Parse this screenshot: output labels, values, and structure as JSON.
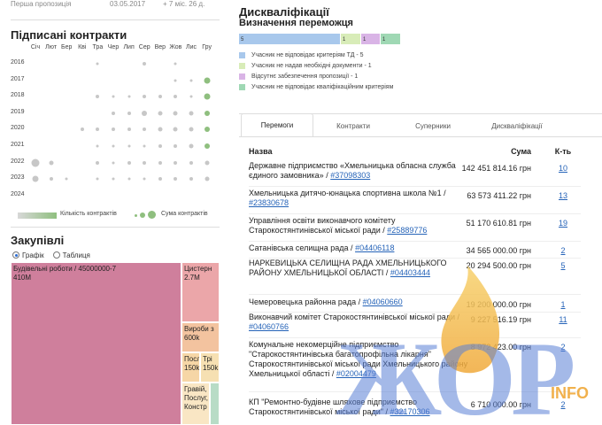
{
  "top_strip": {
    "label": "Перша пропозиція",
    "date": "03.05.2017",
    "duration": "+ 7 міс. 26 д."
  },
  "contracts": {
    "title": "Підписані контракти",
    "months": [
      "Січ",
      "Лют",
      "Бер",
      "Кві",
      "Тра",
      "Чер",
      "Лип",
      "Сер",
      "Вер",
      "Жов",
      "Лис",
      "Гру"
    ],
    "years": [
      "2016",
      "2017",
      "2018",
      "2019",
      "2020",
      "2021",
      "2022",
      "2023",
      "2024"
    ],
    "legend_count": "Кількість контрактів",
    "legend_sum": "Сума контрактів"
  },
  "purchases": {
    "title": "Закупівлі",
    "view_graph": "Графік",
    "view_table": "Таблиця",
    "tiles": [
      {
        "label": "Будівельні роботи / 45000000-7",
        "value": "410М",
        "color": "#cf7f9c"
      },
      {
        "label": "Цистерн",
        "value": "2.7M",
        "color": "#eba6a9"
      },
      {
        "label": "Вироби з",
        "value": "600k",
        "color": "#f3c39f"
      },
      {
        "label": "Посл",
        "value": "150k",
        "color": "#f6d6a6"
      },
      {
        "label": "Трі",
        "value": "150k",
        "color": "#f6e0b2"
      },
      {
        "label": "Гравій, Послуг, Констр",
        "value": "",
        "color": "#f9e6c4"
      },
      {
        "label": "",
        "value": "",
        "color": "#b8dcc6"
      }
    ]
  },
  "disqualifications": {
    "title": "Дискваліфікації",
    "subtitle": "Визначення переможця",
    "bars": [
      {
        "value": "5",
        "color": "#a8c8ec"
      },
      {
        "value": "1",
        "color": "#d8ecb8"
      },
      {
        "value": "1",
        "color": "#d9b4e6"
      },
      {
        "value": "1",
        "color": "#9fd8b4"
      }
    ],
    "legend": [
      {
        "text": "Учасник не відповідає критеріям ТД - 5",
        "color": "#a8c8ec"
      },
      {
        "text": "Учасник не надав необхідні документи - 1",
        "color": "#d8ecb8"
      },
      {
        "text": "Відсутнє забезпечення пропозиції - 1",
        "color": "#d9b4e6"
      },
      {
        "text": "Учасник не відповідає кваліфікаційним критеріям",
        "color": "#9fd8b4"
      }
    ]
  },
  "tabs": [
    "Перемоги",
    "Контракти",
    "Суперники",
    "Дискваліфікації"
  ],
  "table": {
    "col_name": "Назва",
    "col_sum": "Сума",
    "col_count": "К-ть",
    "rows": [
      {
        "name": "Державне підприємство «Хмельницька обласна служба єдиного замовника» / ",
        "code": "#37098303",
        "sum": "142 451 814.16 грн",
        "count": "10"
      },
      {
        "name": "Хмельницька дитячо-юнацька спортивна школа №1 / ",
        "code": "#23830678",
        "sum": "63 573 411.22 грн",
        "count": "13"
      },
      {
        "name": "Управління освіти виконавчого комітету Старокостянтинівської міської ради / ",
        "code": "#25889776",
        "sum": "51 170 610.81 грн",
        "count": "19"
      },
      {
        "name": "Сатанівська селищна рада / ",
        "code": "#04406118",
        "sum": "34 565 000.00 грн",
        "count": "2"
      },
      {
        "name": "НАРКЕВИЦЬКА СЕЛИЩНА РАДА ХМЕЛЬНИЦЬКОГО РАЙОНУ ХМЕЛЬНИЦЬКОЇ ОБЛАСТІ / ",
        "code": "#04403444",
        "sum": "20 294 500.00 грн",
        "count": "5"
      },
      {
        "name": "Чемеровецька районна рада / ",
        "code": "#04060660",
        "sum": "19 200 000.00 грн",
        "count": "1"
      },
      {
        "name": "Виконавчий комітет Старокостянтинівської міської ради / ",
        "code": "#04060766",
        "sum": "9 227 516.19 грн",
        "count": "11"
      },
      {
        "name": "Комунальне некомерційне підприємство \"Старокостянтинівська багатопрофільна лікарня\" Старокостянтинівської міської ради Хмельницького району Хмельницької області / ",
        "code": "#02004479",
        "sum": "8 972 423.00 грн",
        "count": "2"
      },
      {
        "name": "КП \"Ремонтно-будівне шляхове підприємство Старокостянтинівської міської ради\" / ",
        "code": "#32170306",
        "sum": "6 710 000.00 грн",
        "count": "2"
      }
    ]
  },
  "watermark": {
    "text": "ЖОР",
    "suffix": "INFO"
  }
}
